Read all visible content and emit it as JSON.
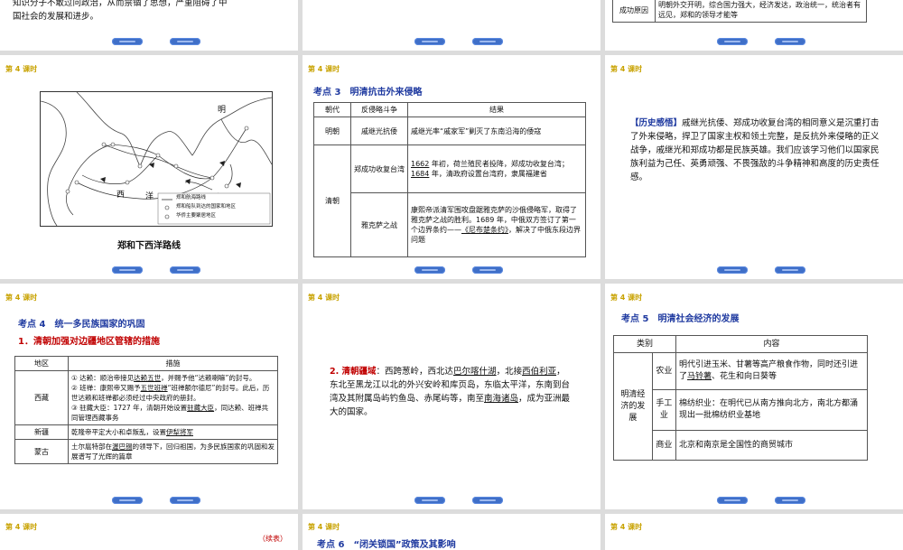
{
  "nav": {
    "prev_label": "",
    "next_label": ""
  },
  "slide1": {
    "text_line1": "知识分子不敢过问政治，从而禁锢了思想，严重阻碍了中",
    "text_line2": "国社会的发展和进步。"
  },
  "slide3": {
    "label": "成功原因",
    "text": "明朝外交开明，综合国力强大，经济发达，政治统一，统治者有远见，郑和的领导才能等"
  },
  "slide4": {
    "lesson": "第 4 课时",
    "map_caption": "郑和下西洋路线",
    "map_labels": [
      "明",
      "西",
      "洋",
      "印",
      "度",
      "洋"
    ],
    "legend": [
      "郑和航海路线",
      "郑和船队到达的国家和地区",
      "华侨主要聚居地区"
    ]
  },
  "slide5": {
    "lesson": "第 4 课时",
    "title": "考点 3　明清抗击外来侵略",
    "headers": [
      "朝代",
      "反侵略斗争",
      "结果"
    ],
    "row1": {
      "dynasty": "明朝",
      "struggle": "戚继光抗倭",
      "result": "戚继光率“戚家军”剿灭了东南沿海的倭寇"
    },
    "qing": "清朝",
    "row2": {
      "struggle": "郑成功收复台湾",
      "r_a": "1662",
      "r_b": " 年初，荷兰殖民者投降，郑成功收复台湾；",
      "r_c": "1684",
      "r_d": " 年，清政府设置台湾府，隶属福建省"
    },
    "row3": {
      "struggle": "雅克萨之战",
      "r_a": "康熙帝派清军围攻盘踞雅克萨的沙俄侵略军，取得了雅克萨之战的胜利。1689 年，中俄双方签订了第一个边界条约——",
      "r_b": "《尼布楚条约》",
      "r_c": "，解决了中俄东段边界问题"
    }
  },
  "slide6": {
    "lesson": "第 4 课时",
    "tag": "【历史感悟】",
    "text": "戚继光抗倭、郑成功收复台湾的相同意义是沉重打击了外来侵略，捍卫了国家主权和领土完整，是反抗外来侵略的正义战争，戚继光和郑成功都是民族英雄。我们应该学习他们以国家民族利益为己任、英勇顽强、不畏强敌的斗争精神和高度的历史责任感。"
  },
  "slide7": {
    "lesson": "第 4 课时",
    "title": "考点 4　统一多民族国家的巩固",
    "subtitle": "1．清朝加强对边疆地区管辖的措施",
    "headers": [
      "地区",
      "措施"
    ],
    "tibet": "西藏",
    "t1a": "① 达赖：顺治帝接见",
    "t1b": "达赖五世",
    "t1c": "，并赐予他“达赖喇嘛”的封号。",
    "t2a": "② 班禅：康熙帝又赐予",
    "t2b": "五世班禅",
    "t2c": "“班禅额尔德尼”的封号。此后，历世达赖和班禅都必须经过中央政府的册封。",
    "t3a": "③ 驻藏大臣：1727 年，清朝开始设置",
    "t3b": "驻藏大臣",
    "t3c": "，同达赖、班禅共同管理西藏事务",
    "xinjiang": "新疆",
    "x_a": "乾隆帝平定大小和卓叛乱，设置",
    "x_b": "伊犁将军",
    "mongolia": "蒙古",
    "m_a": "土尔扈特部在",
    "m_b": "渥巴锡",
    "m_c": "的领导下，回归祖国，为多民族国家的巩固和发展谱写了光辉的篇章"
  },
  "slide8": {
    "lesson": "第 4 课时",
    "head": "2. 清朝疆域",
    "p1": "：西跨葱岭，西北达",
    "u1": "巴尔喀什湖",
    "p2": "，北接",
    "u2": "西伯利亚",
    "p3": "，东北至黑龙江以北的外兴安岭和库页岛，东临太平洋，东南到台湾及其附属岛屿钓鱼岛、赤尾屿等，南至",
    "u3": "南海诸岛",
    "p4": "，成为亚洲最大的国家。"
  },
  "slide9": {
    "lesson": "第 4 课时",
    "title": "考点 5　明清社会经济的发展",
    "headers": [
      "类别",
      "内容"
    ],
    "group": "明清经济的发展",
    "agri": "农业",
    "agri_a": "明代引进玉米、甘薯等高产粮食作物，同时还引进了",
    "agri_b": "马铃薯",
    "agri_c": "、花生和向日葵等",
    "hand": "手工业",
    "hand_text": "棉纺织业：在明代已从南方推向北方，南北方都涌现出一批棉纺织业基地",
    "comm": "商业",
    "comm_text": "北京和南京是全国性的商贸城市"
  },
  "slide10": {
    "lesson": "第 4 课时",
    "continued": "（续表）"
  },
  "slide11": {
    "lesson": "第 4 课时",
    "title": "考点 6　“闭关锁国”政策及其影响"
  },
  "slide12": {
    "lesson": "第 4 课时"
  }
}
